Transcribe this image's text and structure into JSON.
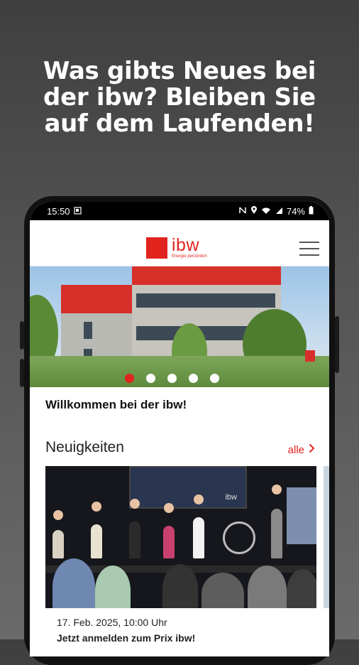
{
  "headline": {
    "lines": [
      "Was gibts Neues bei",
      "der ibw? Bleiben Sie",
      "auf dem Laufenden!"
    ]
  },
  "status": {
    "time": "15:50",
    "battery": "74%"
  },
  "app": {
    "logo_name": "ibw",
    "logo_tagline": "Energie persönlich"
  },
  "content": {
    "welcome": "Willkommen bei der ibw!",
    "news_heading": "Neuigkeiten",
    "all_link": "alle",
    "news_card": {
      "date": "17. Feb. 2025, 10:00 Uhr",
      "title": "Jetzt anmelden zum Prix ibw!"
    },
    "banner_text": "ibw"
  },
  "carousel": {
    "count": 5,
    "active_index": 0
  },
  "colors": {
    "brand_red": "#e2241f"
  }
}
